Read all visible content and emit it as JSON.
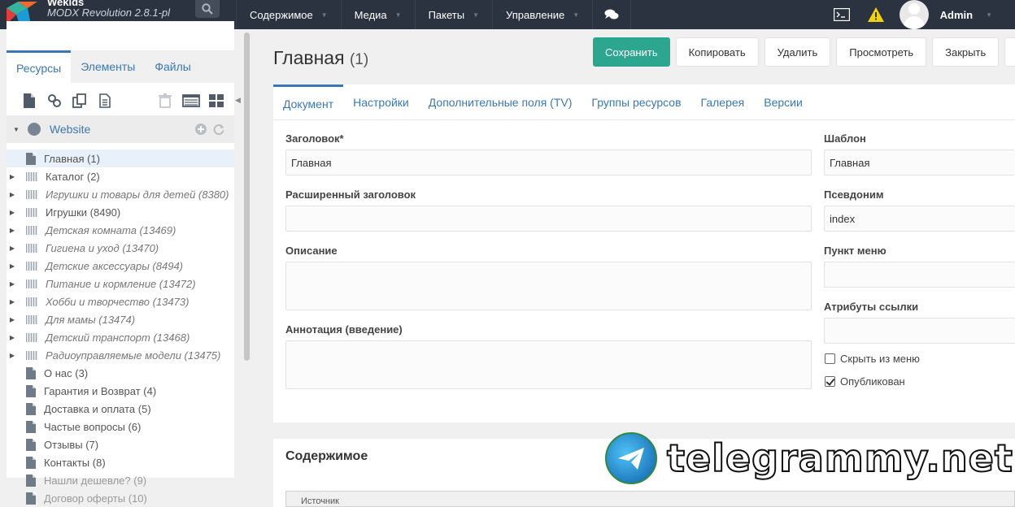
{
  "topbar": {
    "site_name": "Wekids",
    "version": "MODX Revolution 2.8.1-pl",
    "nav": [
      "Содержимое",
      "Медиа",
      "Пакеты",
      "Управление"
    ],
    "user": "Admin"
  },
  "sidebar": {
    "tabs": [
      "Ресурсы",
      "Элементы",
      "Файлы"
    ],
    "root": "Website",
    "items": [
      {
        "label": "Главная (1)",
        "type": "doc",
        "state": "selected"
      },
      {
        "label": "Каталог (2)",
        "type": "folder",
        "state": "normal"
      },
      {
        "label": "Игрушки и товары для детей (8380)",
        "type": "folder",
        "state": "unpub"
      },
      {
        "label": "Игрушки (8490)",
        "type": "folder",
        "state": "normal"
      },
      {
        "label": "Детская комната (13469)",
        "type": "folder",
        "state": "unpub"
      },
      {
        "label": "Гигиена и уход (13470)",
        "type": "folder",
        "state": "unpub"
      },
      {
        "label": "Детские аксессуары (8494)",
        "type": "folder",
        "state": "unpub"
      },
      {
        "label": "Питание и кормление (13472)",
        "type": "folder",
        "state": "unpub"
      },
      {
        "label": "Хобби и творчество (13473)",
        "type": "folder",
        "state": "unpub"
      },
      {
        "label": "Для мамы (13474)",
        "type": "folder",
        "state": "unpub"
      },
      {
        "label": "Детский транспорт (13468)",
        "type": "folder",
        "state": "unpub"
      },
      {
        "label": "Радиоуправляемые модели (13475)",
        "type": "folder",
        "state": "unpub"
      },
      {
        "label": "О нас (3)",
        "type": "doc",
        "state": "normal"
      },
      {
        "label": "Гарантия и Возврат (4)",
        "type": "doc",
        "state": "normal"
      },
      {
        "label": "Доставка и оплата (5)",
        "type": "doc",
        "state": "normal"
      },
      {
        "label": "Частые вопросы (6)",
        "type": "doc",
        "state": "normal"
      },
      {
        "label": "Отзывы (7)",
        "type": "doc",
        "state": "normal"
      },
      {
        "label": "Контакты (8)",
        "type": "doc",
        "state": "normal"
      },
      {
        "label": "Нашли дешевле? (9)",
        "type": "doc",
        "state": "hidden"
      },
      {
        "label": "Договор оферты (10)",
        "type": "doc",
        "state": "hidden"
      }
    ]
  },
  "main": {
    "title": "Главная",
    "title_id": "(1)",
    "buttons": [
      "Сохранить",
      "Копировать",
      "Удалить",
      "Просмотреть",
      "Закрыть"
    ],
    "tabs": [
      "Документ",
      "Настройки",
      "Дополнительные поля (TV)",
      "Группы ресурсов",
      "Галерея",
      "Версии"
    ],
    "fields": {
      "pagetitle_label": "Заголовок*",
      "pagetitle_value": "Главная",
      "longtitle_label": "Расширенный заголовок",
      "longtitle_value": "",
      "description_label": "Описание",
      "introtext_label": "Аннотация (введение)",
      "template_label": "Шаблон",
      "template_value": "Главная",
      "alias_label": "Псевдоним",
      "alias_value": "index",
      "menutitle_label": "Пункт меню",
      "menutitle_value": "",
      "link_attributes_label": "Атрибуты ссылки",
      "link_attributes_value": "",
      "hidemenu_label": "Скрыть из меню",
      "hidemenu_checked": false,
      "published_label": "Опубликован",
      "published_checked": true
    },
    "content_title": "Содержимое",
    "editor_source_label": "Источник"
  },
  "watermark": "telegrammy.net",
  "colors": {
    "topbar": "#2b3240",
    "primary_button": "#2da68f",
    "link": "#3a78b5"
  }
}
